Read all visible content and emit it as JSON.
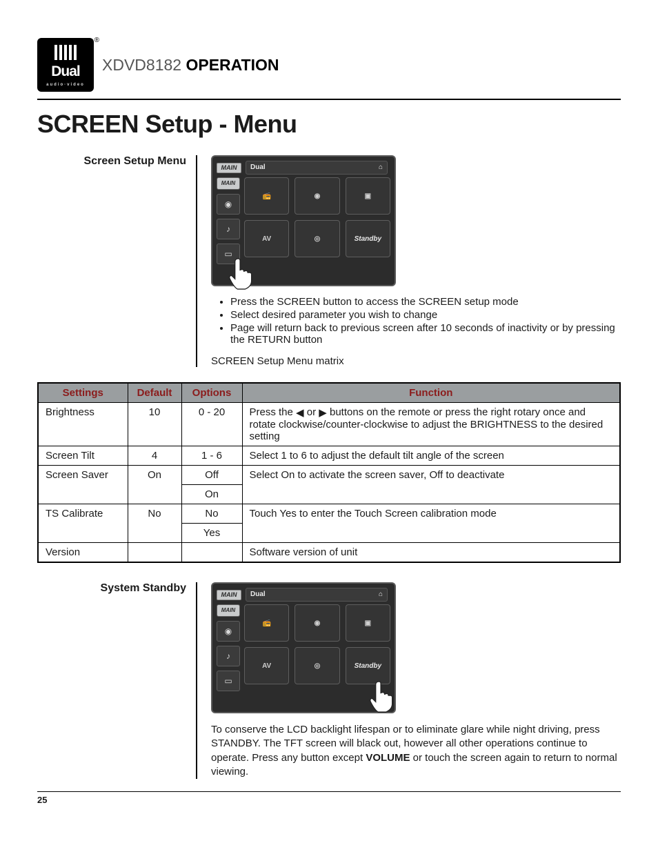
{
  "header": {
    "logo_word": "Dual",
    "logo_sub": "audio·video",
    "model": "XDVD8182",
    "operation": "OPERATION"
  },
  "title": "SCREEN Setup - Menu",
  "section1": {
    "label": "Screen Setup Menu",
    "device": {
      "main_tag": "MAIN",
      "brand": "Dual",
      "standby": "Standby"
    },
    "bullets": [
      "Press the SCREEN button to access the SCREEN setup mode",
      "Select desired parameter you wish to change",
      "Page will return back to previous screen after 10 seconds of inactivity or by pressing the RETURN button"
    ],
    "matrix_caption": "SCREEN Setup Menu matrix"
  },
  "table": {
    "headers": {
      "settings": "Settings",
      "default": "Default",
      "options": "Options",
      "function": "Function"
    },
    "rows": [
      {
        "setting": "Brightness",
        "default": "10",
        "options": [
          "0 - 20"
        ],
        "function_pre": "Press the ",
        "function_mid_a": " or ",
        "function_post": " buttons on the remote or press the right rotary once and rotate clockwise/counter-clockwise to adjust the BRIGHTNESS to the desired setting"
      },
      {
        "setting": "Screen Tilt",
        "default": "4",
        "options": [
          "1 - 6"
        ],
        "function": "Select 1 to 6 to adjust the default tilt angle of the screen"
      },
      {
        "setting": "Screen Saver",
        "default": "On",
        "options": [
          "Off",
          "On"
        ],
        "function": "Select On to activate the screen saver, Off to deactivate"
      },
      {
        "setting": "TS Calibrate",
        "default": "No",
        "options": [
          "No",
          "Yes"
        ],
        "function": "Touch Yes to enter the Touch Screen calibration mode"
      },
      {
        "setting": "Version",
        "default": "",
        "options": [
          ""
        ],
        "function": "Software version of unit"
      }
    ]
  },
  "section2": {
    "label": "System Standby",
    "device": {
      "main_tag": "MAIN",
      "brand": "Dual",
      "standby": "Standby"
    },
    "para_pre": "To conserve the LCD backlight lifespan or to eliminate glare while night driving, press STANDBY. The TFT screen will black out, however all other operations continue to operate. Press any button except ",
    "volume": "VOLUME",
    "para_post": " or touch the screen again to return to normal viewing."
  },
  "page_number": "25"
}
